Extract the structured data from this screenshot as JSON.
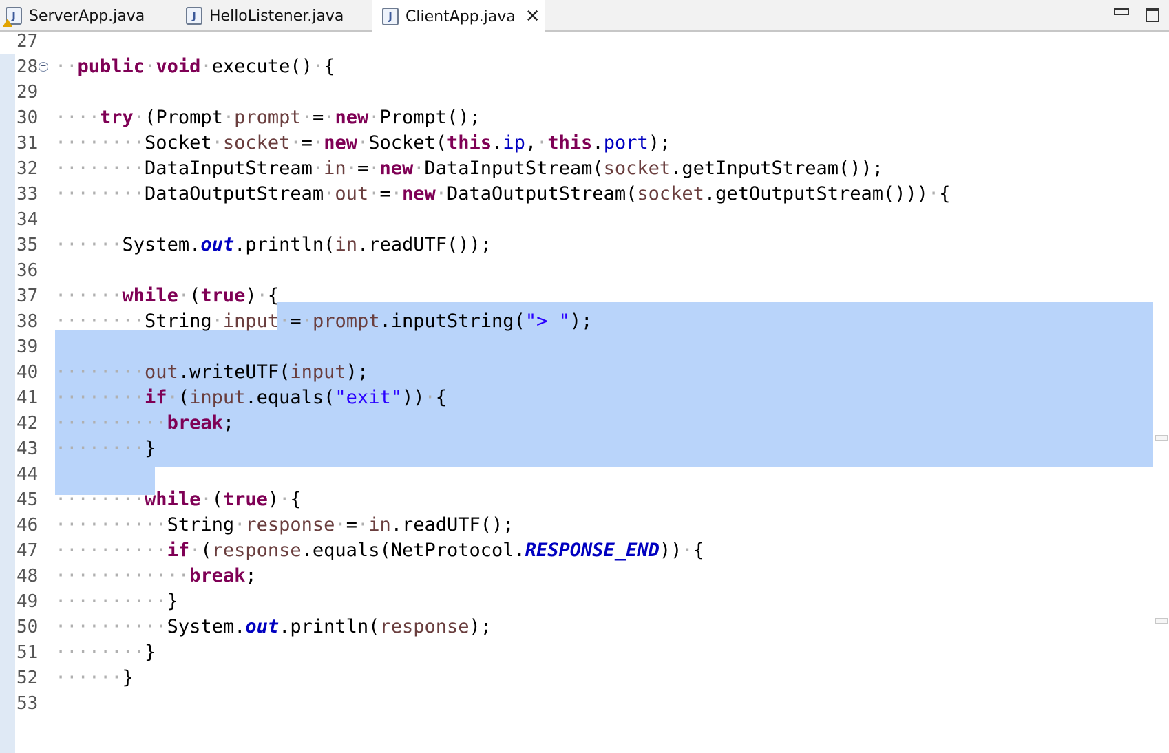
{
  "tabs": [
    {
      "label": "ServerApp.java",
      "icon": "java-file-warning-icon"
    },
    {
      "label": "HelloListener.java",
      "icon": "java-file-icon"
    },
    {
      "label": "ClientApp.java",
      "icon": "java-file-icon",
      "active": true
    }
  ],
  "window": {
    "minimize_icon": "minimize-icon",
    "maximize_icon": "maximize-icon"
  },
  "colors": {
    "keyword": "#7f0055",
    "variable": "#6a3e3e",
    "field": "#0000c0",
    "string": "#2a00ff",
    "selection": "#b9d4fa"
  },
  "lines": [
    {
      "n": "27",
      "t": ""
    },
    {
      "n": "28",
      "t": "··public·void·execute()·{"
    },
    {
      "n": "29",
      "t": ""
    },
    {
      "n": "30",
      "t": "····try·(Prompt·prompt·=·new·Prompt();"
    },
    {
      "n": "31",
      "t": "········Socket·socket·=·new·Socket(this.ip,·this.port);"
    },
    {
      "n": "32",
      "t": "········DataInputStream·in·=·new·DataInputStream(socket.getInputStream());"
    },
    {
      "n": "33",
      "t": "········DataOutputStream·out·=·new·DataOutputStream(socket.getOutputStream()))·{"
    },
    {
      "n": "34",
      "t": ""
    },
    {
      "n": "35",
      "t": "······System.out.println(in.readUTF());"
    },
    {
      "n": "36",
      "t": ""
    },
    {
      "n": "37",
      "t": "······while·(true)·{"
    },
    {
      "n": "38",
      "t": "········String·input·=·prompt.inputString(\"> \");"
    },
    {
      "n": "39",
      "t": ""
    },
    {
      "n": "40",
      "t": "········out.writeUTF(input);"
    },
    {
      "n": "41",
      "t": "········if·(input.equals(\"exit\"))·{"
    },
    {
      "n": "42",
      "t": "··········break;"
    },
    {
      "n": "43",
      "t": "········}"
    },
    {
      "n": "44",
      "t": ""
    },
    {
      "n": "45",
      "t": "········while·(true)·{"
    },
    {
      "n": "46",
      "t": "··········String·response·=·in.readUTF();"
    },
    {
      "n": "47",
      "t": "··········if·(response.equals(NetProtocol.RESPONSE_END))·{"
    },
    {
      "n": "48",
      "t": "············break;"
    },
    {
      "n": "49",
      "t": "··········}"
    },
    {
      "n": "50",
      "t": "··········System.out.println(response);"
    },
    {
      "n": "51",
      "t": "········}"
    },
    {
      "n": "52",
      "t": "······}"
    },
    {
      "n": "53",
      "t": ""
    }
  ]
}
